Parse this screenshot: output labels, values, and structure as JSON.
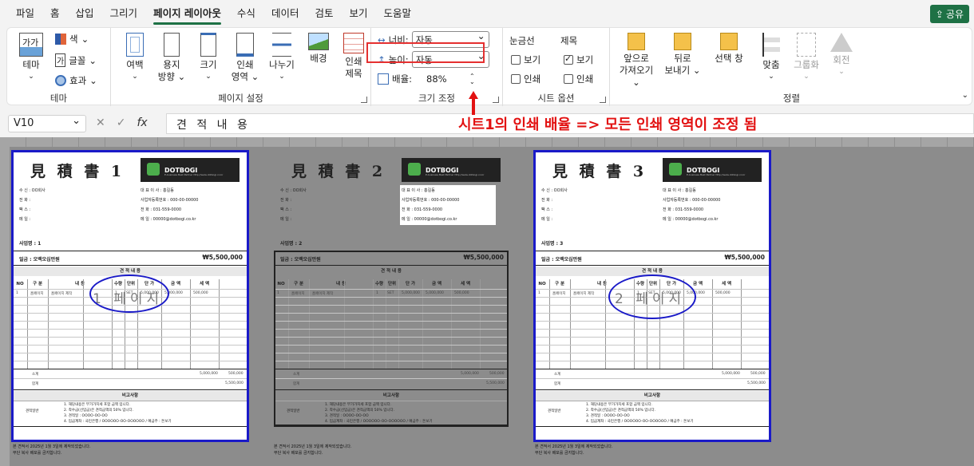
{
  "tabs": [
    "파일",
    "홈",
    "삽입",
    "그리기",
    "페이지 레이아웃",
    "수식",
    "데이터",
    "검토",
    "보기",
    "도움말"
  ],
  "share": "공유",
  "ribbon": {
    "theme": {
      "themes": "테마",
      "colors": "색",
      "fonts": "글꼴",
      "effects": "효과",
      "label": "테마"
    },
    "page_setup": {
      "margins": "여백",
      "orientation_1": "용지",
      "orientation_2": "방향",
      "size": "크기",
      "print_area_1": "인쇄",
      "print_area_2": "영역",
      "breaks": "나누기",
      "background": "배경",
      "titles_1": "인쇄",
      "titles_2": "제목",
      "label": "페이지 설정"
    },
    "scale": {
      "width_label": "너비:",
      "width_value": "자동",
      "height_label": "높이:",
      "height_value": "자동",
      "scale_label": "배율:",
      "scale_value": "88%",
      "label": "크기 조정"
    },
    "sheet_options": {
      "gridlines": "눈금선",
      "headings": "제목",
      "view": "보기",
      "print": "인쇄",
      "label": "시트 옵션"
    },
    "arrange": {
      "bring_forward_1": "앞으로",
      "bring_forward_2": "가져오기",
      "send_backward_1": "뒤로",
      "send_backward_2": "보내기",
      "selection_pane": "선택 창",
      "align": "맞춤",
      "group": "그룹화",
      "rotate": "회전",
      "label": "정렬"
    }
  },
  "formula_bar": {
    "name_box": "V10",
    "fx": "fx",
    "content": "견 적 내 용"
  },
  "annotation": "시트1의 인쇄 배율 => 모든 인쇄 영역이 조정 됨",
  "pages": [
    {
      "title": "見 積 書 1",
      "project": "사업명 : 1",
      "watermark": "1 페이지"
    },
    {
      "title": "見 積 書 2",
      "project": "사업명 : 2",
      "watermark": ""
    },
    {
      "title": "見 積 書 3",
      "project": "사업명 : 3",
      "watermark": "2 페이지"
    }
  ],
  "quote": {
    "logo": "DOTBOGI",
    "logo_sub": "E-business Best Partner  http://www.dotbogi.co.kr",
    "left_fields": [
      "수 신 : OO회사",
      "전 화 :",
      "팩 스 :",
      "메 일 :"
    ],
    "right_fields": [
      "대 표 이 사 : 홍길동",
      "사업자등록번호 : 000-00-00000",
      "전 화 : 031-559-0000",
      "메 일 : 00000@dotbogi.co.kr"
    ],
    "amount_label": "일금 : 오백오십만원",
    "amount_value": "₩5,500,000",
    "section": "견 적 내 용",
    "headers": [
      "NO",
      "구 분",
      "내 용",
      "수량",
      "단위",
      "단 가",
      "금 액",
      "세 액"
    ],
    "row": [
      "1",
      "홈페이지",
      "홈페이지 제작",
      "1",
      "SET",
      "5,000,000",
      "5,000,000",
      "500,000"
    ],
    "subtotal_label": "소계",
    "subtotal_amount": "5,000,000",
    "subtotal_tax": "500,000",
    "total_label": "합계",
    "total_value": "5,500,000",
    "remarks_title": "비고사항",
    "remarks_label": "견적일반",
    "remarks": [
      "1. 해당내용은 부가가치세 포함 금액 입니다.",
      "2. 착수금(선입금)은 견적금액의 50% 입니다.",
      "3. 견적일 : OOOO-OO-OO",
      "4. 입금계좌 : 국민은행 / OOOOOO-OO-OOOOOO / 예금주 : 돈보기"
    ],
    "footer": [
      "본 견적서 2025년 1월 3일에 제작되었습니다.",
      "무단 복사 배포를 금지합니다."
    ]
  },
  "colors": {
    "accent": "#1e7145",
    "annotation": "#e21212",
    "frame": "#1a1ac8"
  }
}
